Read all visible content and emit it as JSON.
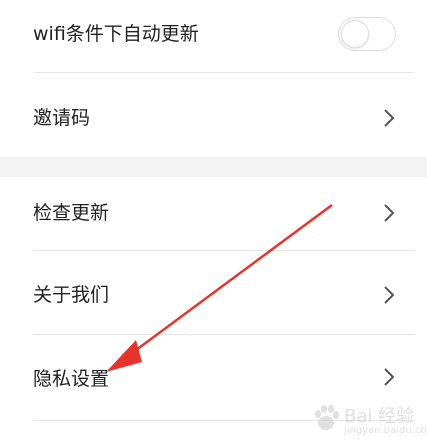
{
  "settings": {
    "wifi_auto_update": {
      "label": "wifi条件下自动更新",
      "toggle_on": false
    },
    "invite_code": {
      "label": "邀请码"
    },
    "check_update": {
      "label": "检查更新"
    },
    "about_us": {
      "label": "关于我们"
    },
    "privacy_settings": {
      "label": "隐私设置"
    }
  },
  "annotation": {
    "arrow_color": "#e8332c"
  },
  "watermark": {
    "brand_icon": "baidu-paw-icon",
    "text": "Bai 经验",
    "subtext": "jingyan.baidu.com"
  },
  "colors": {
    "background": "#ffffff",
    "section_gap": "#f3f3f3",
    "divider": "#e6e6e6",
    "text": "#222222",
    "chevron": "#555555"
  }
}
